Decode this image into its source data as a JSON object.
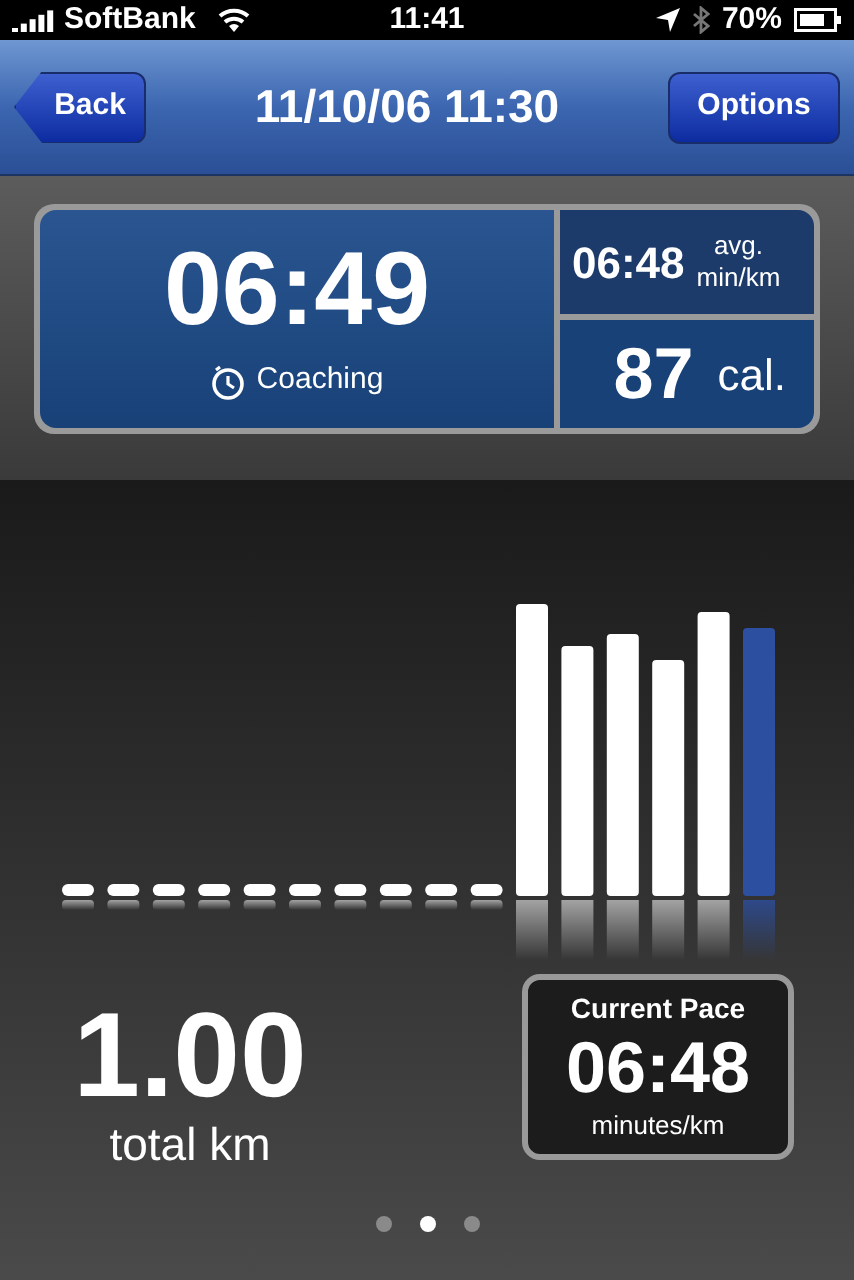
{
  "status_bar": {
    "carrier": "SoftBank",
    "time": "11:41",
    "battery": "70%"
  },
  "nav_bar": {
    "back": "Back",
    "title": "11/10/06 11:30",
    "options": "Options"
  },
  "summary": {
    "duration": "06:49",
    "mode": "Coaching",
    "avg_pace": "06:48",
    "avg_label_1": "avg.",
    "avg_label_2": "min/km",
    "calories": "87",
    "calories_unit": "cal."
  },
  "distance": {
    "value": "1.00",
    "unit": "total km"
  },
  "current_pace": {
    "title": "Current Pace",
    "value": "06:48",
    "unit": "minutes/km"
  },
  "page_dots": [
    {
      "selected": false
    },
    {
      "selected": true
    },
    {
      "selected": false
    }
  ]
}
